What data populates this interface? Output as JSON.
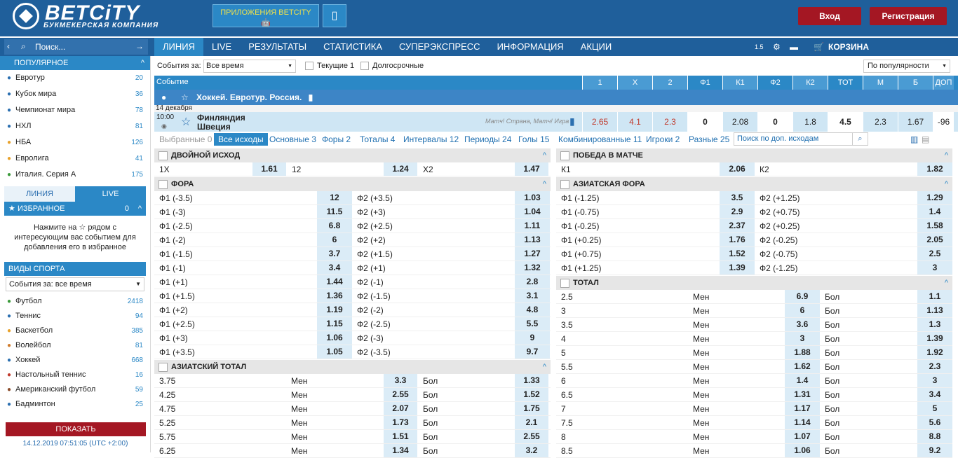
{
  "header": {
    "logo": "BETCiTY",
    "logo_sub": "БУКМЕКЕРСКАЯ КОМПАНИЯ",
    "apps": "ПРИЛОЖЕНИЯ BETCITY",
    "apps_icons": "🤖 ",
    "login": "Вход",
    "register": "Регистрация"
  },
  "nav": {
    "search_placeholder": "Поиск...",
    "tabs": [
      "ЛИНИЯ",
      "LIVE",
      "РЕЗУЛЬТАТЫ",
      "СТАТИСТИКА",
      "СУПЕРЭКСПРЕСС",
      "ИНФОРМАЦИЯ",
      "АКЦИИ"
    ],
    "odds_fmt": "1.5",
    "cart": "КОРЗИНА"
  },
  "sidebar": {
    "popular_title": "ПОПУЛЯРНОЕ",
    "popular": [
      {
        "label": "Евротур",
        "count": "20"
      },
      {
        "label": "Кубок мира",
        "count": "36"
      },
      {
        "label": "Чемпионат мира",
        "count": "78"
      },
      {
        "label": "НХЛ",
        "count": "81"
      },
      {
        "label": "НБА",
        "count": "126"
      },
      {
        "label": "Евролига",
        "count": "41"
      },
      {
        "label": "Италия. Серия А",
        "count": "175"
      }
    ],
    "tab_line": "ЛИНИЯ",
    "tab_live": "LIVE",
    "fav_title": "ИЗБРАННОЕ",
    "fav_count": "0",
    "fav_hint": "Нажмите на ☆ рядом с интересующим вас событием для добавления его в избранное",
    "sports_title": "ВИДЫ СПОРТА",
    "sports_filter": "События за: все время",
    "sports": [
      {
        "label": "Футбол",
        "count": "2418"
      },
      {
        "label": "Теннис",
        "count": "94"
      },
      {
        "label": "Баскетбол",
        "count": "385"
      },
      {
        "label": "Волейбол",
        "count": "81"
      },
      {
        "label": "Хоккей",
        "count": "668"
      },
      {
        "label": "Настольный теннис",
        "count": "16"
      },
      {
        "label": "Американский футбол",
        "count": "59"
      },
      {
        "label": "Бадминтон",
        "count": "25"
      }
    ],
    "show": "ПОКАЗАТЬ",
    "datetime": "14.12.2019 07:51:05 (UTC +2:00)"
  },
  "filters": {
    "events_for": "События за:",
    "period": "Все время",
    "current": "Текущие 1",
    "long": "Долгосрочные",
    "sort": "По популярности"
  },
  "table_head": {
    "event": "Событие",
    "cols": [
      "1",
      "X",
      "2",
      "Ф1",
      "К1",
      "Ф2",
      "К2",
      "ТОТ",
      "М",
      "Б",
      "ДОП"
    ]
  },
  "league": "Хоккей. Евротур. Россия.",
  "event": {
    "date": "14 декабря",
    "time": "10:00",
    "team1": "Финляндия",
    "team2": "Швеция",
    "stats": "Матч! Страна, Матч! Игра",
    "odds": [
      "2.65",
      "4.1",
      "2.3",
      "0",
      "2.08",
      "0",
      "1.8",
      "4.5",
      "2.3",
      "1.67",
      "-96"
    ]
  },
  "subtabs": [
    "Выбранные 0",
    "Все исходы",
    "Основные 3",
    "Форы 2",
    "Тоталы 4",
    "Интервалы 12",
    "Периоды 24",
    "Голы 15",
    "Комбинированные 11",
    "Игроки 2",
    "Разные 25"
  ],
  "subsearch": "Поиск по доп. исходам",
  "double": {
    "title": "ДВОЙНОЙ ИСХОД",
    "rows": [
      [
        "1X",
        "1.61",
        "12",
        "1.24",
        "X2",
        "1.47"
      ]
    ]
  },
  "win": {
    "title": "ПОБЕДА В МАТЧЕ",
    "rows": [
      [
        "К1",
        "2.06",
        "К2",
        "1.82"
      ]
    ]
  },
  "fora": {
    "title": "ФОРА",
    "rows": [
      [
        "Ф1 (-3.5)",
        "12",
        "Ф2 (+3.5)",
        "1.03"
      ],
      [
        "Ф1 (-3)",
        "11.5",
        "Ф2 (+3)",
        "1.04"
      ],
      [
        "Ф1 (-2.5)",
        "6.8",
        "Ф2 (+2.5)",
        "1.11"
      ],
      [
        "Ф1 (-2)",
        "6",
        "Ф2 (+2)",
        "1.13"
      ],
      [
        "Ф1 (-1.5)",
        "3.7",
        "Ф2 (+1.5)",
        "1.27"
      ],
      [
        "Ф1 (-1)",
        "3.4",
        "Ф2 (+1)",
        "1.32"
      ],
      [
        "Ф1 (+1)",
        "1.44",
        "Ф2 (-1)",
        "2.8"
      ],
      [
        "Ф1 (+1.5)",
        "1.36",
        "Ф2 (-1.5)",
        "3.1"
      ],
      [
        "Ф1 (+2)",
        "1.19",
        "Ф2 (-2)",
        "4.8"
      ],
      [
        "Ф1 (+2.5)",
        "1.15",
        "Ф2 (-2.5)",
        "5.5"
      ],
      [
        "Ф1 (+3)",
        "1.06",
        "Ф2 (-3)",
        "9"
      ],
      [
        "Ф1 (+3.5)",
        "1.05",
        "Ф2 (-3.5)",
        "9.7"
      ]
    ]
  },
  "asia_fora": {
    "title": "АЗИАТСКАЯ ФОРА",
    "rows": [
      [
        "Ф1 (-1.25)",
        "3.5",
        "Ф2 (+1.25)",
        "1.29"
      ],
      [
        "Ф1 (-0.75)",
        "2.9",
        "Ф2 (+0.75)",
        "1.4"
      ],
      [
        "Ф1 (-0.25)",
        "2.37",
        "Ф2 (+0.25)",
        "1.58"
      ],
      [
        "Ф1 (+0.25)",
        "1.76",
        "Ф2 (-0.25)",
        "2.05"
      ],
      [
        "Ф1 (+0.75)",
        "1.52",
        "Ф2 (-0.75)",
        "2.5"
      ],
      [
        "Ф1 (+1.25)",
        "1.39",
        "Ф2 (-1.25)",
        "3"
      ]
    ]
  },
  "total": {
    "title": "ТОТАЛ",
    "rows": [
      [
        "2.5",
        "Мен",
        "6.9",
        "Бол",
        "1.1"
      ],
      [
        "3",
        "Мен",
        "6",
        "Бол",
        "1.13"
      ],
      [
        "3.5",
        "Мен",
        "3.6",
        "Бол",
        "1.3"
      ],
      [
        "4",
        "Мен",
        "3",
        "Бол",
        "1.39"
      ],
      [
        "5",
        "Мен",
        "1.88",
        "Бол",
        "1.92"
      ],
      [
        "5.5",
        "Мен",
        "1.62",
        "Бол",
        "2.3"
      ],
      [
        "6",
        "Мен",
        "1.4",
        "Бол",
        "3"
      ],
      [
        "6.5",
        "Мен",
        "1.31",
        "Бол",
        "3.4"
      ],
      [
        "7",
        "Мен",
        "1.17",
        "Бол",
        "5"
      ],
      [
        "7.5",
        "Мен",
        "1.14",
        "Бол",
        "5.6"
      ],
      [
        "8",
        "Мен",
        "1.07",
        "Бол",
        "8.8"
      ],
      [
        "8.5",
        "Мен",
        "1.06",
        "Бол",
        "9.2"
      ]
    ]
  },
  "asia_total": {
    "title": "АЗИАТСКИЙ ТОТАЛ",
    "rows": [
      [
        "3.75",
        "Мен",
        "3.3",
        "Бол",
        "1.33"
      ],
      [
        "4.25",
        "Мен",
        "2.55",
        "Бол",
        "1.52"
      ],
      [
        "4.75",
        "Мен",
        "2.07",
        "Бол",
        "1.75"
      ],
      [
        "5.25",
        "Мен",
        "1.73",
        "Бол",
        "2.1"
      ],
      [
        "5.75",
        "Мен",
        "1.51",
        "Бол",
        "2.55"
      ],
      [
        "6.25",
        "Мен",
        "1.34",
        "Бол",
        "3.2"
      ]
    ]
  }
}
